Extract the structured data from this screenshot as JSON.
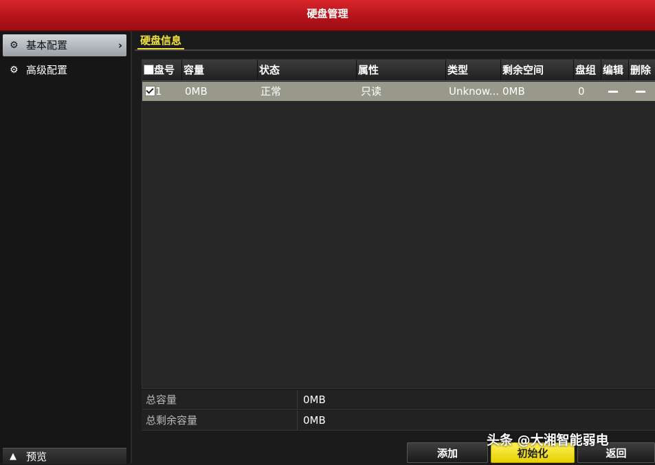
{
  "window": {
    "title": "硬盘管理"
  },
  "sidebar": {
    "items": [
      {
        "label": "基本配置",
        "icon": "gear-icon",
        "active": true
      },
      {
        "label": "高级配置",
        "icon": "gear-icon",
        "active": false
      }
    ],
    "preview_label": "预览"
  },
  "tabs": [
    {
      "label": "硬盘信息"
    }
  ],
  "table": {
    "headers": [
      "盘号",
      "容量",
      "状态",
      "属性",
      "类型",
      "剩余空间",
      "盘组",
      "编辑",
      "删除"
    ],
    "rows": [
      {
        "checked": true,
        "no": "1",
        "capacity": "0MB",
        "status": "正常",
        "attr": "只读",
        "type": "Unknow...",
        "free": "0MB",
        "group": "0"
      }
    ]
  },
  "summary": {
    "total_capacity_label": "总容量",
    "total_capacity": "0MB",
    "total_free_label": "总剩余容量",
    "total_free": "0MB"
  },
  "buttons": {
    "add": "添加",
    "init": "初始化",
    "back": "返回"
  },
  "watermark": "头条 @大湘智能弱电"
}
